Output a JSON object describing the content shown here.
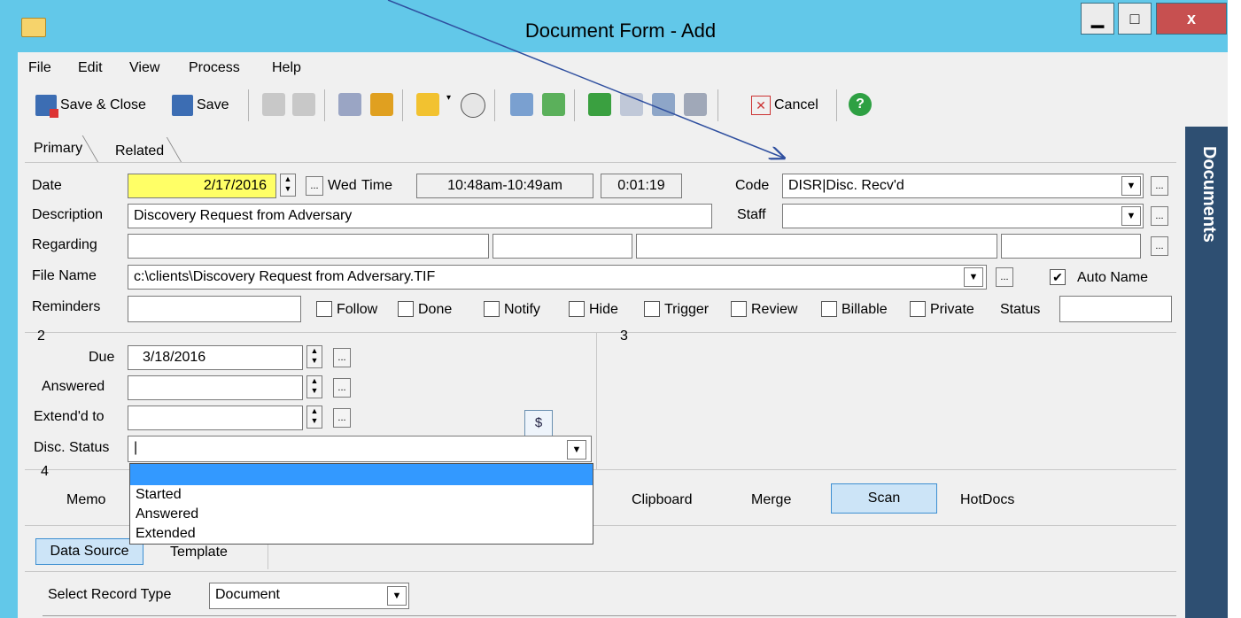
{
  "window": {
    "title": "Document Form - Add",
    "minimize": "▁",
    "maximize": "□",
    "close": "x"
  },
  "menu": [
    "File",
    "Edit",
    "View",
    "Process",
    "Help"
  ],
  "toolbar": {
    "save_close": "Save & Close",
    "save": "Save",
    "cancel": "Cancel"
  },
  "tabs": [
    "Primary",
    "Related"
  ],
  "sidebar_title": "Documents",
  "form": {
    "date_label": "Date",
    "date_value": "2/17/2016",
    "day": "Wed",
    "time_label": "Time",
    "time_value": "10:48am-10:49am",
    "duration": "0:01:19",
    "code_label": "Code",
    "code_value": "DISR|Disc. Recv'd",
    "description_label": "Description",
    "description_value": "Discovery Request from Adversary",
    "staff_label": "Staff",
    "staff_value": "",
    "regarding_label": "Regarding",
    "filename_label": "File Name",
    "filename_value": "c:\\clients\\Discovery Request from Adversary.TIF",
    "autoname_label": "Auto Name",
    "reminders_label": "Reminders",
    "status_label": "Status",
    "checkboxes": [
      "Follow",
      "Done",
      "Notify",
      "Hide",
      "Trigger",
      "Review",
      "Billable",
      "Private"
    ]
  },
  "section2": {
    "number": "2",
    "due_label": "Due",
    "due_value": "3/18/2016",
    "answered_label": "Answered",
    "extended_label": "Extend'd to",
    "disc_status_label": "Disc. Status",
    "dollar_button": "$",
    "dropdown_options": [
      "",
      "Started",
      "Answered",
      "Extended"
    ]
  },
  "section3": {
    "number": "3"
  },
  "section4": {
    "number": "4",
    "memo": "Memo",
    "clipboard": "Clipboard",
    "merge": "Merge",
    "scan": "Scan",
    "hotdocs": "HotDocs"
  },
  "subtabs": {
    "data_source": "Data Source",
    "template": "Template"
  },
  "record_type": {
    "label": "Select Record Type",
    "value": "Document"
  },
  "colors": {
    "titlebar": "#62c8e9",
    "sidebar": "#2e4f72",
    "date_highlight": "#ffff66",
    "dropdown_selected": "#3399ff",
    "close_button": "#c75050"
  }
}
